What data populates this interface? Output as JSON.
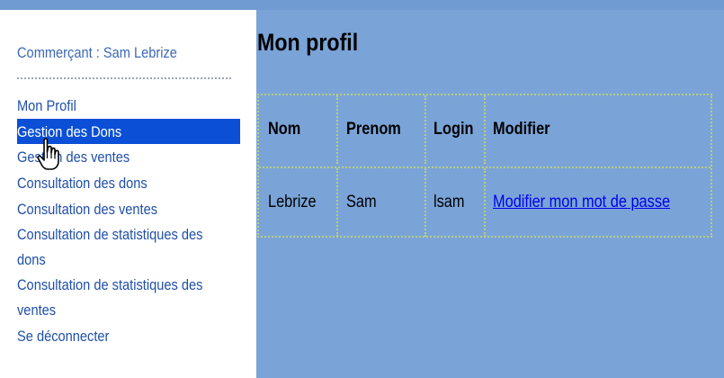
{
  "sidebar": {
    "merchant_label": "Commerçant : Sam Lebrize",
    "items": [
      {
        "label": "Mon Profil"
      },
      {
        "label": "Gestion des Dons"
      },
      {
        "label": "Gestion des ventes"
      },
      {
        "label": "Consultation des dons"
      },
      {
        "label": "Consultation des ventes"
      },
      {
        "label": "Consultation de statistiques des dons"
      },
      {
        "label": "Consultation de statistiques des ventes"
      },
      {
        "label": "Se déconnecter"
      }
    ],
    "active_index": 1
  },
  "main": {
    "title": "Mon profil",
    "table": {
      "headers": [
        "Nom",
        "Prenom",
        "Login",
        "Modifier"
      ],
      "rows": [
        [
          "Lebrize",
          "Sam",
          "lsam",
          "Modifier mon mot de passe"
        ]
      ]
    }
  },
  "colors": {
    "background": "#7aa4d8",
    "active_item": "#0a4fd6",
    "link": "#0000ee",
    "menu_text": "#1f4fa8"
  },
  "icons": {
    "cursor": "hand-pointer-icon"
  }
}
